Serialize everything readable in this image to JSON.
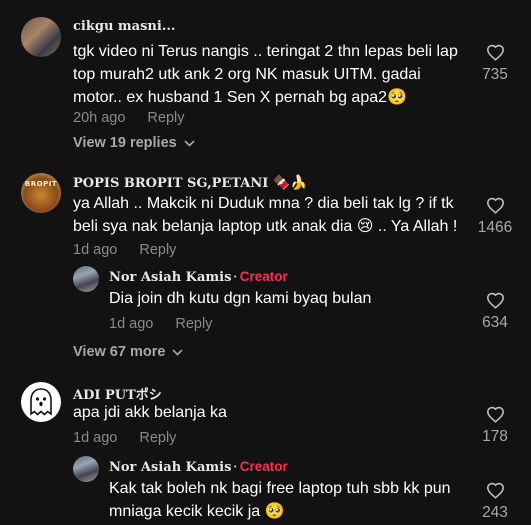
{
  "comments": [
    {
      "username": "cikgu masni...",
      "text_lines": [
        "tgk video ni Terus nangis .. teringat 2 thn lepas beli lap",
        "top murah2 utk ank 2 org NK masuk UITM. gadai",
        "motor.. ex husband 1 Sen X pernah bg apa2🥺"
      ],
      "time": "20h ago",
      "reply_label": "Reply",
      "likes": "735",
      "view_replies": "View 19 replies"
    },
    {
      "username": "POPIS BROPIT SG,PETANI",
      "username_emoji": "🍫🍌",
      "avatar_text": "BROPIT",
      "text_lines": [
        "ya Allah .. Makcik ni Duduk mna ? dia beli tak lg ? if tk",
        "beli sya nak belanja laptop utk anak dia 😢 .. Ya Allah !"
      ],
      "time": "1d ago",
      "reply_label": "Reply",
      "likes": "1466",
      "reply": {
        "username": "Nor Asiah Kamis",
        "creator_label": "Creator",
        "text": "Dia join dh kutu dgn kami byaq bulan",
        "time": "1d ago",
        "reply_label": "Reply",
        "likes": "634"
      },
      "view_more": "View 67 more"
    },
    {
      "username": "ADI PUTポシ",
      "text_lines": [
        "apa jdi akk belanja ka"
      ],
      "time": "1d ago",
      "reply_label": "Reply",
      "likes": "178",
      "reply": {
        "username": "Nor Asiah Kamis",
        "creator_label": "Creator",
        "text_lines": [
          "Kak tak boleh nk bagi free laptop tuh sbb kk pun",
          "mniaga kecik kecik ja 🥺"
        ],
        "likes": "243"
      }
    }
  ],
  "icons": {
    "like": "heart-outline-icon",
    "expand": "chevron-down-icon",
    "ghost_avatar": "ghost-icon"
  },
  "colors": {
    "background": "#121212",
    "creator": "#fe2c55",
    "secondary_text": "#8a8a8a"
  }
}
